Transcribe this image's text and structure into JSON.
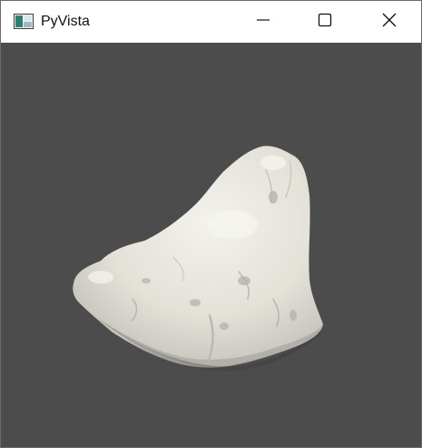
{
  "window": {
    "title": "PyVista",
    "app_icon": "pyvista-window-icon",
    "controls": {
      "minimize_icon": "minimize-icon",
      "maximize_icon": "maximize-icon",
      "close_icon": "close-icon"
    }
  },
  "viewport": {
    "background_color": "#4c4c4c",
    "mesh_color": "#e6e4dc",
    "content": "3d-rock-mesh"
  }
}
